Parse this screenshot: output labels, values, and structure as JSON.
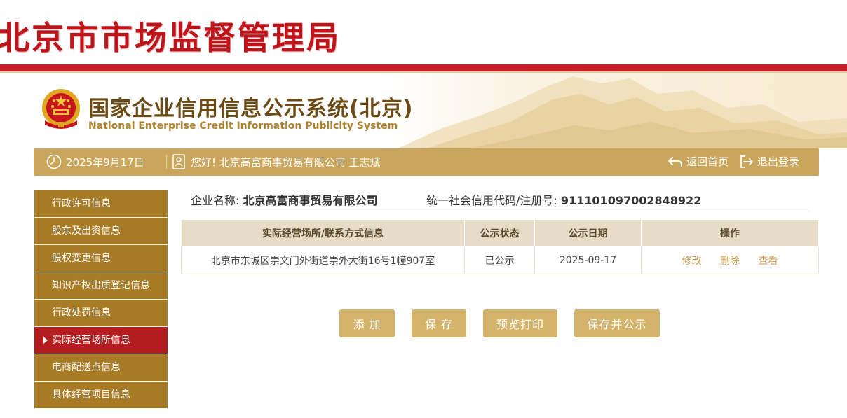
{
  "agency": {
    "title": "北京市市场监督管理局"
  },
  "system": {
    "title_cn": "国家企业信用信息公示系统(北京)",
    "title_en": "National Enterprise Credit Information Publicity System"
  },
  "info_bar": {
    "date": "2025年9月17日",
    "greeting": "您好! 北京高富商事贸易有限公司  王志斌",
    "home_label": "返回首页",
    "logout_label": "退出登录"
  },
  "sidebar": {
    "items": [
      {
        "label": "行政许可信息",
        "active": false
      },
      {
        "label": "股东及出资信息",
        "active": false
      },
      {
        "label": "股权变更信息",
        "active": false
      },
      {
        "label": "知识产权出质登记信息",
        "active": false
      },
      {
        "label": "行政处罚信息",
        "active": false
      },
      {
        "label": "实际经营场所信息",
        "active": true
      },
      {
        "label": "电商配送点信息",
        "active": false
      },
      {
        "label": "具体经营项目信息",
        "active": false
      }
    ]
  },
  "company": {
    "name_label": "企业名称:",
    "name": "北京高富商事贸易有限公司",
    "code_label": "统一社会信用代码/注册号:",
    "code": "911101097002848922"
  },
  "table": {
    "headers": [
      "实际经营场所/联系方式信息",
      "公示状态",
      "公示日期",
      "操作"
    ],
    "rows": [
      {
        "address": "北京市东城区崇文门外街道崇外大街16号1幢907室",
        "status": "已公示",
        "date": "2025-09-17",
        "actions": [
          "修改",
          "删除",
          "查看"
        ]
      }
    ]
  },
  "buttons": {
    "add": "添 加",
    "save": "保 存",
    "print": "预览打印",
    "publish": "保存并公示"
  },
  "colors": {
    "agency_red": "#c0141b",
    "gold": "#caa65c",
    "sidebar_gold": "#a87b26",
    "sidebar_active": "#b41d1f",
    "button": "#d4b36a"
  }
}
